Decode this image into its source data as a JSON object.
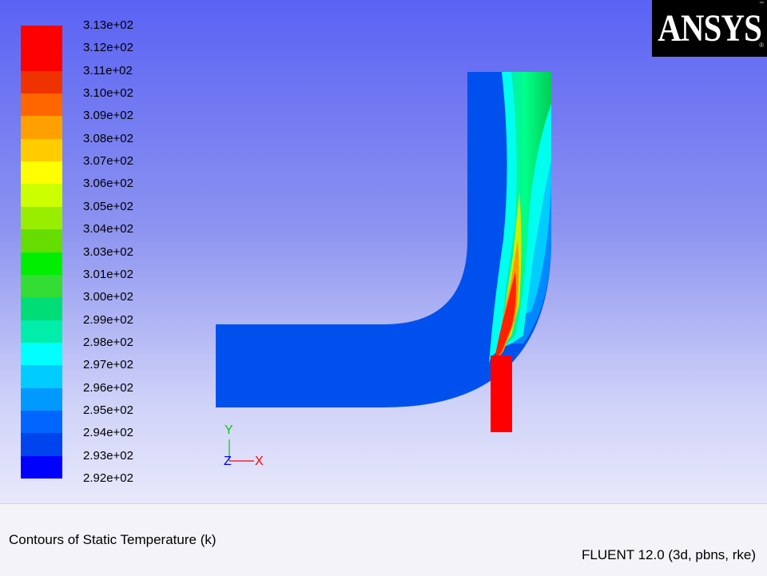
{
  "legend": {
    "labels": [
      "3.13e+02",
      "3.12e+02",
      "3.11e+02",
      "3.10e+02",
      "3.09e+02",
      "3.08e+02",
      "3.07e+02",
      "3.06e+02",
      "3.05e+02",
      "3.04e+02",
      "3.03e+02",
      "3.01e+02",
      "3.00e+02",
      "2.99e+02",
      "2.98e+02",
      "2.97e+02",
      "2.96e+02",
      "2.95e+02",
      "2.94e+02",
      "2.93e+02",
      "2.92e+02"
    ],
    "colors": [
      "#ff0000",
      "#ff0000",
      "#ee3300",
      "#ff6600",
      "#ffa000",
      "#ffcc00",
      "#ffff00",
      "#ccff00",
      "#99ee00",
      "#66dd00",
      "#00ee00",
      "#33dd33",
      "#00dd77",
      "#00eeaa",
      "#00ffff",
      "#00ccff",
      "#0099ff",
      "#0066ff",
      "#0044ee",
      "#0000ff"
    ]
  },
  "logo": {
    "text": "ANSYS",
    "registered": "®",
    "trademark": "™"
  },
  "axes": {
    "y": "Y",
    "z": "Z",
    "x": "X"
  },
  "footer": {
    "title": "Contours of Static Temperature (k)",
    "solver": "FLUENT 12.0 (3d, pbns, rke)"
  },
  "colors": {
    "cold": "#0050ee",
    "hot": "#ff0000",
    "axis_x": "#ff0000",
    "axis_y": "#00cc00",
    "axis_z": "#0000ff"
  }
}
